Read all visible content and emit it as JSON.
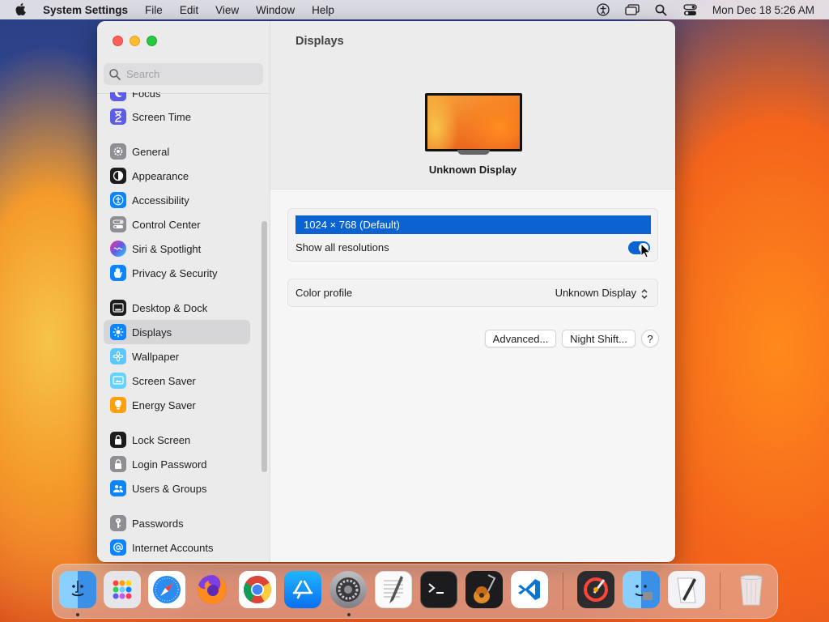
{
  "menubar": {
    "app_name": "System Settings",
    "menus": [
      "File",
      "Edit",
      "View",
      "Window",
      "Help"
    ],
    "datetime": "Mon Dec 18  5:26 AM"
  },
  "sidebar": {
    "search_placeholder": "Search",
    "items": [
      {
        "label": "Focus",
        "icon": "moon-icon"
      },
      {
        "label": "Screen Time",
        "icon": "hourglass-icon"
      },
      {
        "label": "General",
        "icon": "gear-icon"
      },
      {
        "label": "Appearance",
        "icon": "appearance-icon"
      },
      {
        "label": "Accessibility",
        "icon": "accessibility-icon"
      },
      {
        "label": "Control Center",
        "icon": "control-center-icon"
      },
      {
        "label": "Siri & Spotlight",
        "icon": "siri-icon"
      },
      {
        "label": "Privacy & Security",
        "icon": "hand-icon"
      },
      {
        "label": "Desktop & Dock",
        "icon": "dock-icon"
      },
      {
        "label": "Displays",
        "icon": "sun-icon"
      },
      {
        "label": "Wallpaper",
        "icon": "flower-icon"
      },
      {
        "label": "Screen Saver",
        "icon": "screen-saver-icon"
      },
      {
        "label": "Energy Saver",
        "icon": "lightbulb-icon"
      },
      {
        "label": "Lock Screen",
        "icon": "lock-icon"
      },
      {
        "label": "Login Password",
        "icon": "padlock-icon"
      },
      {
        "label": "Users & Groups",
        "icon": "users-icon"
      },
      {
        "label": "Passwords",
        "icon": "key-icon"
      },
      {
        "label": "Internet Accounts",
        "icon": "at-icon"
      }
    ],
    "selected": "Displays"
  },
  "main": {
    "title": "Displays",
    "display_name": "Unknown Display",
    "resolution_selected": "1024 × 768 (Default)",
    "show_all_label": "Show all resolutions",
    "show_all_on": true,
    "color_profile_label": "Color profile",
    "color_profile_value": "Unknown Display",
    "advanced_button": "Advanced...",
    "night_shift_button": "Night Shift...",
    "help_button": "?"
  },
  "colors": {
    "accent": "#0a63d1",
    "close": "#ff5f57",
    "minimize": "#febc2e",
    "maximize": "#28c840"
  },
  "dock": {
    "apps": [
      "Finder",
      "Launchpad",
      "Safari",
      "Firefox",
      "Chrome",
      "App Store",
      "System Settings",
      "TextEdit",
      "Terminal",
      "GarageBand",
      "Visual Studio Code",
      "Instruments",
      "Migration Assistant",
      "Script Editor",
      "Trash"
    ]
  }
}
